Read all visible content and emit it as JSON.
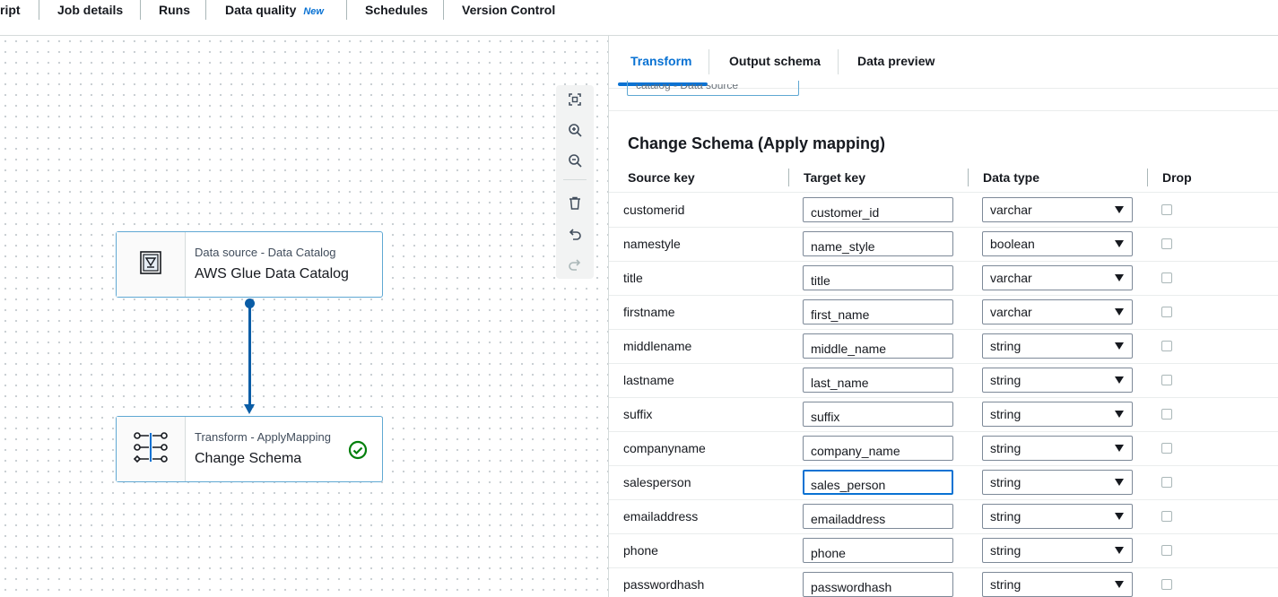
{
  "top_tabs": [
    {
      "label": "ript"
    },
    {
      "label": "Job details"
    },
    {
      "label": "Runs"
    },
    {
      "label": "Data quality",
      "badge": "New"
    },
    {
      "label": "Schedules"
    },
    {
      "label": "Version Control"
    }
  ],
  "canvas": {
    "toolbar": [
      "fit-view-icon",
      "zoom-in-icon",
      "zoom-out-icon",
      "delete-icon",
      "undo-icon",
      "redo-icon"
    ],
    "nodes": [
      {
        "subtitle": "Data source - Data Catalog",
        "title": "AWS Glue Data Catalog",
        "icon": "data-catalog-icon"
      },
      {
        "subtitle": "Transform - ApplyMapping",
        "title": "Change Schema",
        "icon": "apply-mapping-icon",
        "status": "success"
      }
    ]
  },
  "panel": {
    "tabs": [
      {
        "label": "Transform",
        "active": true
      },
      {
        "label": "Output schema"
      },
      {
        "label": "Data preview"
      }
    ],
    "partial_field_text": "catalog - Data source",
    "section_title": "Change Schema (Apply mapping)",
    "columns": [
      "Source key",
      "Target key",
      "Data type",
      "Drop"
    ],
    "rows": [
      {
        "source": "customerid",
        "target": "customer_id",
        "type": "varchar"
      },
      {
        "source": "namestyle",
        "target": "name_style",
        "type": "boolean"
      },
      {
        "source": "title",
        "target": "title",
        "type": "varchar"
      },
      {
        "source": "firstname",
        "target": "first_name",
        "type": "varchar"
      },
      {
        "source": "middlename",
        "target": "middle_name",
        "type": "string"
      },
      {
        "source": "lastname",
        "target": "last_name",
        "type": "string"
      },
      {
        "source": "suffix",
        "target": "suffix",
        "type": "string"
      },
      {
        "source": "companyname",
        "target": "company_name",
        "type": "string"
      },
      {
        "source": "salesperson",
        "target": "sales_person",
        "type": "string",
        "focused": true
      },
      {
        "source": "emailaddress",
        "target": "emailaddress",
        "type": "string"
      },
      {
        "source": "phone",
        "target": "phone",
        "type": "string"
      },
      {
        "source": "passwordhash",
        "target": "passwordhash",
        "type": "string"
      }
    ]
  },
  "colors": {
    "accent": "#0972d3",
    "edge": "#0b5da6",
    "success": "#037f0c",
    "node_border": "#5fa8d3"
  }
}
